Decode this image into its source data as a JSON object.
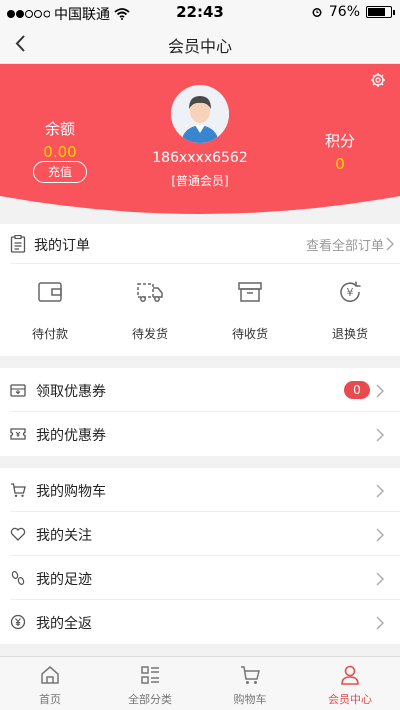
{
  "status_bar": {
    "carrier": "中国联通",
    "time": "22:43",
    "battery_percent": "76%",
    "battery_level": 0.76
  },
  "nav": {
    "title": "会员中心"
  },
  "profile": {
    "balance_label": "余额",
    "balance_value": "0.00",
    "recharge_label": "充值",
    "phone": "186xxxx6562",
    "member_level": "[普通会员]",
    "points_label": "积分",
    "points_value": "0"
  },
  "orders": {
    "title": "我的订单",
    "view_all": "查看全部订单",
    "items": [
      {
        "label": "待付款",
        "icon": "wallet-icon"
      },
      {
        "label": "待发货",
        "icon": "truck-icon"
      },
      {
        "label": "待收货",
        "icon": "box-icon"
      },
      {
        "label": "退换货",
        "icon": "refund-icon"
      }
    ]
  },
  "coupons": {
    "items": [
      {
        "label": "领取优惠券",
        "icon": "coupon-get-icon",
        "badge": "0"
      },
      {
        "label": "我的优惠券",
        "icon": "coupon-icon"
      }
    ]
  },
  "menu": {
    "items": [
      {
        "label": "我的购物车",
        "icon": "cart-icon"
      },
      {
        "label": "我的关注",
        "icon": "heart-icon"
      },
      {
        "label": "我的足迹",
        "icon": "footprint-icon"
      },
      {
        "label": "我的全返",
        "icon": "cashback-icon"
      }
    ]
  },
  "tabbar": {
    "items": [
      {
        "label": "首页",
        "icon": "home-icon"
      },
      {
        "label": "全部分类",
        "icon": "category-icon"
      },
      {
        "label": "购物车",
        "icon": "cart-icon"
      },
      {
        "label": "会员中心",
        "icon": "user-icon"
      }
    ],
    "active_color": "#e84b4f"
  },
  "colors": {
    "brand": "#f9545b",
    "accent_yellow": "#ffd400"
  }
}
